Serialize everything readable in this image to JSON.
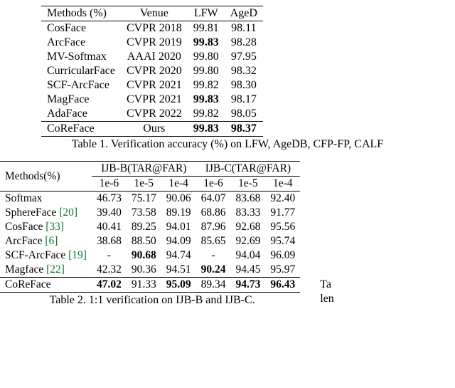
{
  "table1": {
    "headers": [
      "Methods (%)",
      "Venue",
      "LFW",
      "AgeD"
    ],
    "rows": [
      {
        "method": "CosFace",
        "venue": "CVPR 2018",
        "lfw": "99.81",
        "aged": "98.11",
        "lfw_bold": false,
        "aged_bold": false
      },
      {
        "method": "ArcFace",
        "venue": "CVPR 2019",
        "lfw": "99.83",
        "aged": "98.28",
        "lfw_bold": true,
        "aged_bold": false
      },
      {
        "method": "MV-Softmax",
        "venue": "AAAI 2020",
        "lfw": "99.80",
        "aged": "97.95",
        "lfw_bold": false,
        "aged_bold": false
      },
      {
        "method": "CurricularFace",
        "venue": "CVPR 2020",
        "lfw": "99.80",
        "aged": "98.32",
        "lfw_bold": false,
        "aged_bold": false
      },
      {
        "method": "SCF-ArcFace",
        "venue": "CVPR 2021",
        "lfw": "99.82",
        "aged": "98.30",
        "lfw_bold": false,
        "aged_bold": false
      },
      {
        "method": "MagFace",
        "venue": "CVPR 2021",
        "lfw": "99.83",
        "aged": "98.17",
        "lfw_bold": true,
        "aged_bold": false
      },
      {
        "method": "AdaFace",
        "venue": "CVPR 2022",
        "lfw": "99.82",
        "aged": "98.05",
        "lfw_bold": false,
        "aged_bold": false
      }
    ],
    "last_row": {
      "method": "CoReFace",
      "venue": "Ours",
      "lfw": "99.83",
      "aged": "98.37",
      "lfw_bold": true,
      "aged_bold": true
    },
    "caption": "Table 1. Verification accuracy (%) on LFW, AgeDB, CFP-FP, CALF"
  },
  "table2": {
    "h_methods": "Methods(%)",
    "h_ijbb": "IJB-B(TAR@FAR)",
    "h_ijbc": "IJB-C(TAR@FAR)",
    "subheaders": [
      "1e-6",
      "1e-5",
      "1e-4",
      "1e-6",
      "1e-5",
      "1e-4"
    ],
    "rows": [
      {
        "method": "Softmax",
        "cite": "",
        "v": [
          "46.73",
          "75.17",
          "90.06",
          "64.07",
          "83.68",
          "92.40"
        ],
        "bold": [
          0,
          0,
          0,
          0,
          0,
          0
        ]
      },
      {
        "method": "SphereFace ",
        "cite": "[20]",
        "v": [
          "39.40",
          "73.58",
          "89.19",
          "68.86",
          "83.33",
          "91.77"
        ],
        "bold": [
          0,
          0,
          0,
          0,
          0,
          0
        ]
      },
      {
        "method": "CosFace ",
        "cite": "[33]",
        "v": [
          "40.41",
          "89.25",
          "94.01",
          "87.96",
          "92.68",
          "95.56"
        ],
        "bold": [
          0,
          0,
          0,
          0,
          0,
          0
        ]
      },
      {
        "method": "ArcFace ",
        "cite": "[6]",
        "v": [
          "38.68",
          "88.50",
          "94.09",
          "85.65",
          "92.69",
          "95.74"
        ],
        "bold": [
          0,
          0,
          0,
          0,
          0,
          0
        ]
      },
      {
        "method": "SCF-ArcFace ",
        "cite": "[19]",
        "v": [
          "-",
          "90.68",
          "94.74",
          "-",
          "94.04",
          "96.09"
        ],
        "bold": [
          0,
          1,
          0,
          0,
          0,
          0
        ]
      },
      {
        "method": "Magface ",
        "cite": "[22]",
        "v": [
          "42.32",
          "90.36",
          "94.51",
          "90.24",
          "94.45",
          "95.97"
        ],
        "bold": [
          0,
          0,
          0,
          1,
          0,
          0
        ]
      }
    ],
    "last_row": {
      "method": "CoReFace",
      "v": [
        "47.02",
        "91.33",
        "95.09",
        "89.34",
        "94.73",
        "96.43"
      ],
      "bold": [
        1,
        0,
        1,
        0,
        1,
        1
      ]
    },
    "caption": "Table 2. 1:1 verification on IJB-B and IJB-C.",
    "right_fragment1": "Ta",
    "right_fragment2": "len"
  },
  "chart_data": [
    {
      "type": "table",
      "title": "Table 1. Verification accuracy (%) on LFW, AgeDB, CFP-FP, CALF",
      "columns": [
        "Methods (%)",
        "Venue",
        "LFW",
        "AgeD"
      ],
      "rows": [
        [
          "CosFace",
          "CVPR 2018",
          99.81,
          98.11
        ],
        [
          "ArcFace",
          "CVPR 2019",
          99.83,
          98.28
        ],
        [
          "MV-Softmax",
          "AAAI 2020",
          99.8,
          97.95
        ],
        [
          "CurricularFace",
          "CVPR 2020",
          99.8,
          98.32
        ],
        [
          "SCF-ArcFace",
          "CVPR 2021",
          99.82,
          98.3
        ],
        [
          "MagFace",
          "CVPR 2021",
          99.83,
          98.17
        ],
        [
          "AdaFace",
          "CVPR 2022",
          99.82,
          98.05
        ],
        [
          "CoReFace",
          "Ours",
          99.83,
          98.37
        ]
      ]
    },
    {
      "type": "table",
      "title": "Table 2. 1:1 verification on IJB-B and IJB-C.",
      "columns": [
        "Methods(%)",
        "IJB-B 1e-6",
        "IJB-B 1e-5",
        "IJB-B 1e-4",
        "IJB-C 1e-6",
        "IJB-C 1e-5",
        "IJB-C 1e-4"
      ],
      "rows": [
        [
          "Softmax",
          46.73,
          75.17,
          90.06,
          64.07,
          83.68,
          92.4
        ],
        [
          "SphereFace",
          39.4,
          73.58,
          89.19,
          68.86,
          83.33,
          91.77
        ],
        [
          "CosFace",
          40.41,
          89.25,
          94.01,
          87.96,
          92.68,
          95.56
        ],
        [
          "ArcFace",
          38.68,
          88.5,
          94.09,
          85.65,
          92.69,
          95.74
        ],
        [
          "SCF-ArcFace",
          null,
          90.68,
          94.74,
          null,
          94.04,
          96.09
        ],
        [
          "Magface",
          42.32,
          90.36,
          94.51,
          90.24,
          94.45,
          95.97
        ],
        [
          "CoReFace",
          47.02,
          91.33,
          95.09,
          89.34,
          94.73,
          96.43
        ]
      ]
    }
  ]
}
